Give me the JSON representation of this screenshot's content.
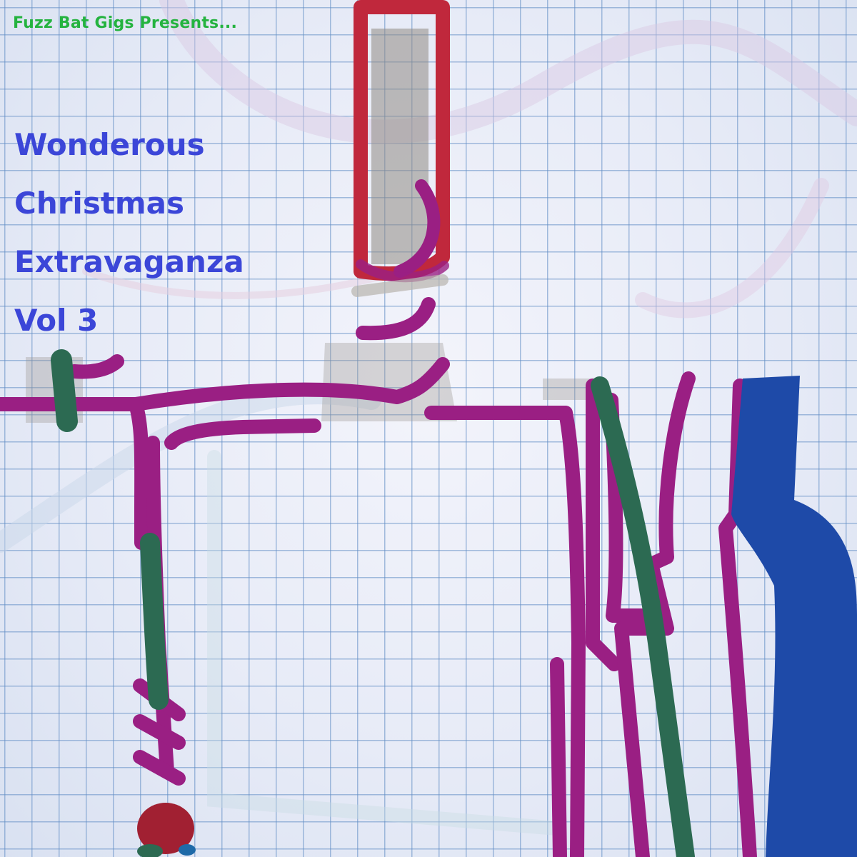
{
  "cover": {
    "presenter": "Fuzz Bat Gigs Presents...",
    "title_lines": [
      "Wonderous",
      "Christmas",
      "Extravaganza",
      "Vol 3"
    ]
  },
  "colors": {
    "presenter_text": "#24b33f",
    "title_text": "#3b46d8",
    "marker_magenta": "#9a1f83",
    "marker_green": "#2c6a52",
    "marker_blue": "#1e4aa8",
    "marker_red": "#c0283c",
    "marker_grey": "#8f8a84",
    "grid_lines": "#608cc4"
  }
}
